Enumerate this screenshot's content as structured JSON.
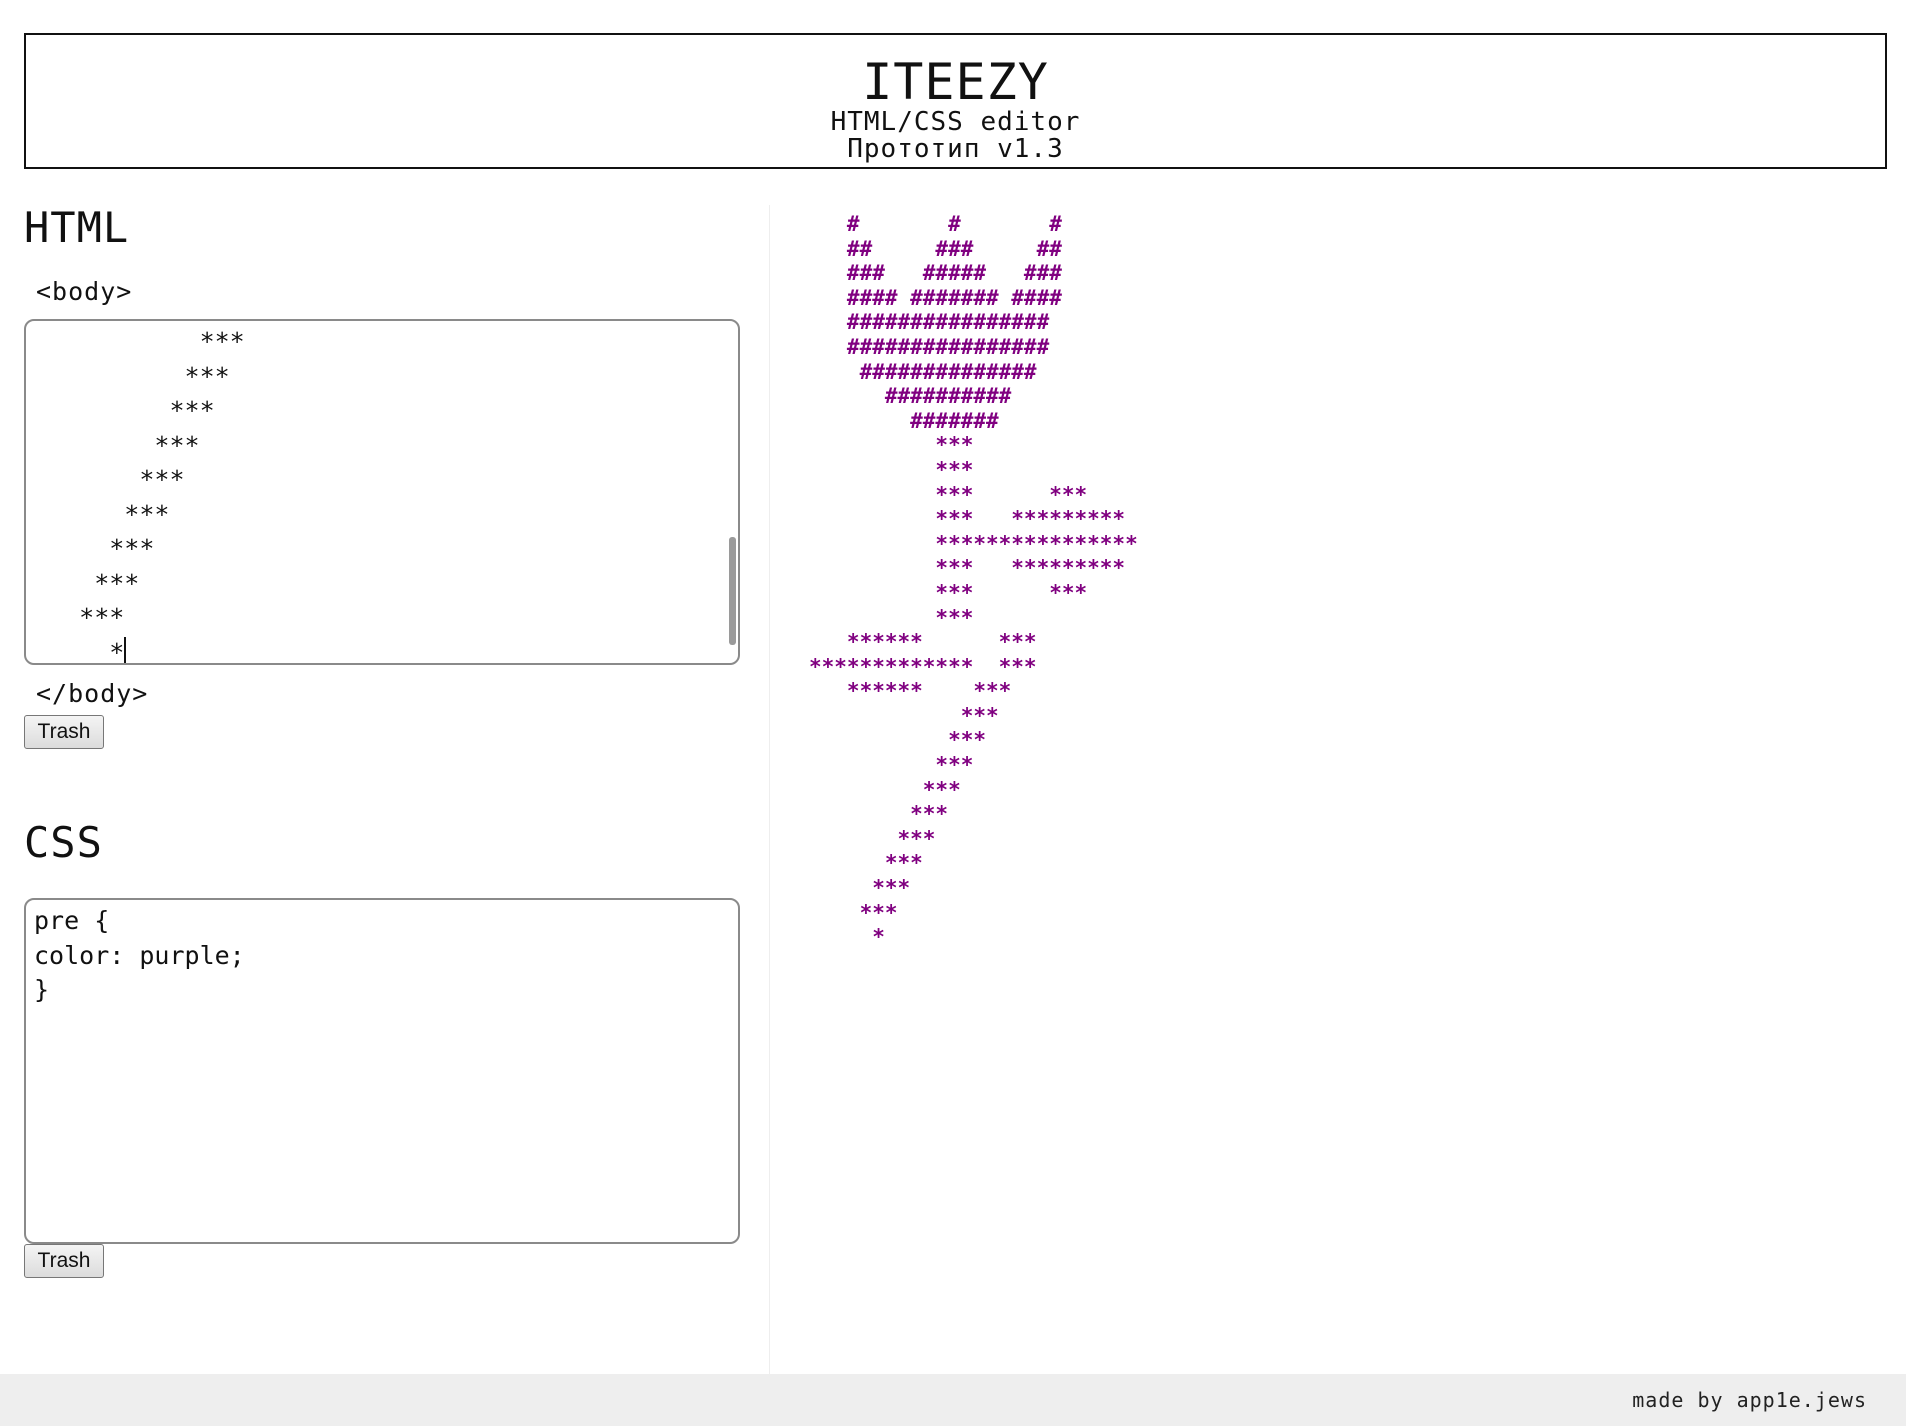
{
  "header": {
    "title": "ITEEZY",
    "subtitle": "HTML/CSS editor",
    "version": "Прототип v1.3"
  },
  "html_section": {
    "title": "HTML",
    "open_tag": "<body>",
    "close_tag": "</body>",
    "code": "           ***\n          ***\n         ***\n        ***\n       ***\n      ***\n     ***\n    ***\n   ***\n     *",
    "trash_label": "Trash"
  },
  "css_section": {
    "title": "CSS",
    "code": "pre {\ncolor: purple;\n}",
    "trash_label": "Trash"
  },
  "preview": {
    "text_color": "#800080",
    "content": "   #       #       #\n   ##     ###     ##\n   ###   #####   ###\n   #### ####### ####\n   ################\n   ################\n    ##############\n      ##########\n        #######\n          ***\n          ***\n          ***      ***\n          ***   *********\n          ****************\n          ***   *********\n          ***      ***\n          ***\n   ******      ***\n*************  ***\n   ******    ***\n            ***\n           ***\n          ***\n         ***\n        ***\n       ***\n      ***\n     ***\n    ***\n     *"
  },
  "footer": {
    "credit": "made by app1e.jews"
  }
}
